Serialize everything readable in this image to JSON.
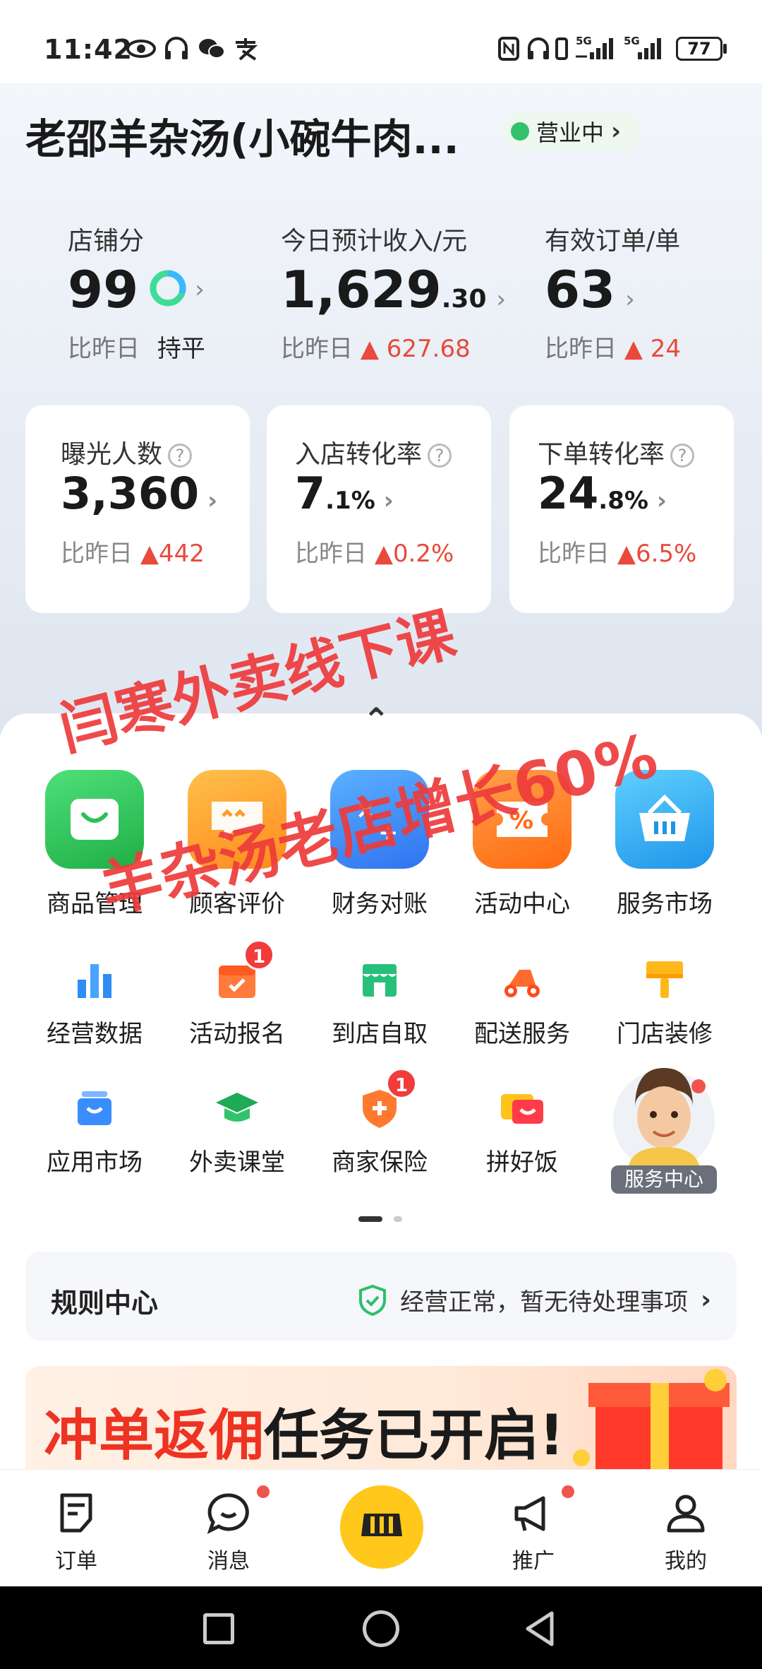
{
  "status_bar": {
    "time": "11:42",
    "network_left": "5G",
    "network_right": "5G",
    "battery": "77"
  },
  "header": {
    "store_name": "老邵羊杂汤(小碗牛肉...",
    "status": "营业中"
  },
  "kpis": [
    {
      "label": "店铺分",
      "value": "99",
      "decimal": "",
      "compare_label": "比昨日",
      "compare_value": "持平",
      "trend": "flat"
    },
    {
      "label": "今日预计收入/元",
      "value": "1,629",
      "decimal": ".30",
      "compare_label": "比昨日",
      "compare_value": "627.68",
      "trend": "up"
    },
    {
      "label": "有效订单/单",
      "value": "63",
      "decimal": "",
      "compare_label": "比昨日",
      "compare_value": "24",
      "trend": "up"
    }
  ],
  "metrics": [
    {
      "label": "曝光人数",
      "value": "3,360",
      "decimal": "",
      "compare_label": "比昨日",
      "compare_value": "442"
    },
    {
      "label": "入店转化率",
      "value": "7",
      "decimal": ".1%",
      "compare_label": "比昨日",
      "compare_value": "0.2%"
    },
    {
      "label": "下单转化率",
      "value": "24",
      "decimal": ".8%",
      "compare_label": "比昨日",
      "compare_value": "6.5%"
    }
  ],
  "watermark": {
    "line1": "闫寒外卖线下课",
    "line2": "羊杂汤老店增长60%"
  },
  "grid": {
    "row1": [
      {
        "label": "商品管理",
        "icon": "product-icon",
        "color": "#32c35a"
      },
      {
        "label": "顾客评价",
        "icon": "review-icon",
        "color": "#ff9a2e"
      },
      {
        "label": "财务对账",
        "icon": "finance-icon",
        "color": "#3a8dff"
      },
      {
        "label": "活动中心",
        "icon": "coupon-icon",
        "color": "#ff7a1f"
      },
      {
        "label": "服务市场",
        "icon": "basket-icon",
        "color": "#2fa8ef"
      }
    ],
    "row2": [
      {
        "label": "经营数据",
        "icon": "bar-chart-icon",
        "badge": ""
      },
      {
        "label": "活动报名",
        "icon": "calendar-icon",
        "badge": "1"
      },
      {
        "label": "到店自取",
        "icon": "store-icon",
        "badge": ""
      },
      {
        "label": "配送服务",
        "icon": "scooter-icon",
        "badge": ""
      },
      {
        "label": "门店装修",
        "icon": "paint-brush-icon",
        "badge": ""
      }
    ],
    "row3": [
      {
        "label": "应用市场",
        "icon": "app-bag-icon",
        "badge": ""
      },
      {
        "label": "外卖课堂",
        "icon": "graduation-cap-icon",
        "badge": ""
      },
      {
        "label": "商家保险",
        "icon": "shield-plus-icon",
        "badge": "1"
      },
      {
        "label": "拼好饭",
        "icon": "ticket-icon",
        "badge": ""
      }
    ],
    "service_center_label": "服务中心"
  },
  "rules": {
    "title": "规则中心",
    "status": "经营正常，暂无待处理事项"
  },
  "banner": {
    "red_text": "冲单返佣",
    "black_text": "任务已开启!"
  },
  "bottom_nav": [
    {
      "label": "订单",
      "icon": "order-icon"
    },
    {
      "label": "消息",
      "icon": "message-icon"
    },
    {
      "label": "",
      "icon": "store-center-icon"
    },
    {
      "label": "推广",
      "icon": "megaphone-icon"
    },
    {
      "label": "我的",
      "icon": "profile-icon"
    }
  ]
}
